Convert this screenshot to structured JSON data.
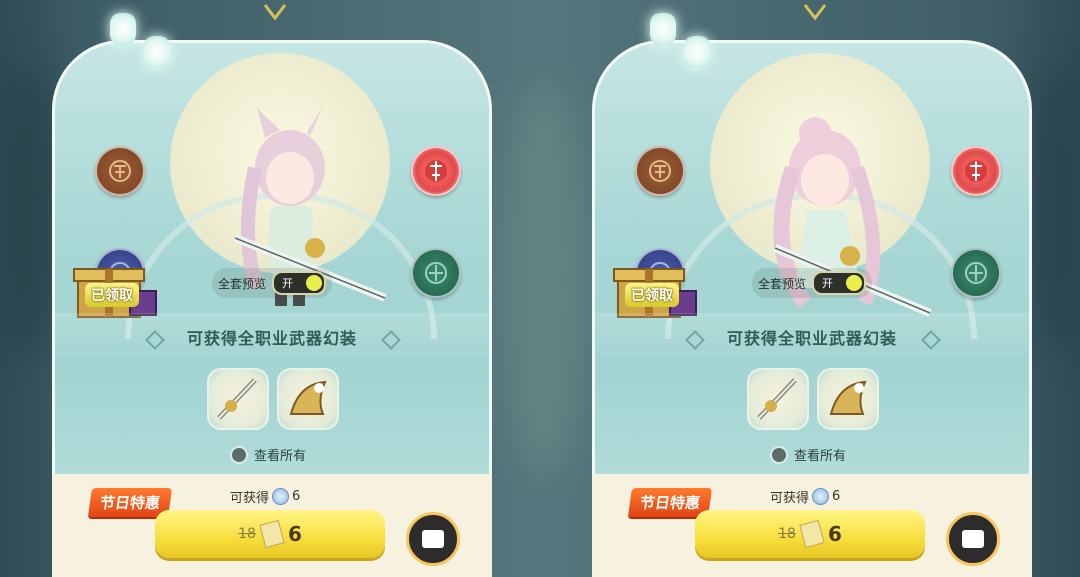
{
  "panels": [
    {
      "received_label": "已领取",
      "preview_label": "全套预览",
      "toggle_text": "开",
      "section_title": "可获得全职业武器幻装",
      "view_all": "查看所有",
      "promo_tag": "节日特惠",
      "obtain_label": "可获得",
      "obtain_count": "6",
      "old_price": "18",
      "new_price": "6"
    },
    {
      "received_label": "已领取",
      "preview_label": "全套预览",
      "toggle_text": "开",
      "section_title": "可获得全职业武器幻装",
      "view_all": "查看所有",
      "promo_tag": "节日特惠",
      "obtain_label": "可获得",
      "obtain_count": "6",
      "old_price": "18",
      "new_price": "6"
    }
  ],
  "colors": {
    "accent": "#f6df3c",
    "tag": "#e04416",
    "panel": "#a9d8d6"
  },
  "icons": [
    "lantern-icon",
    "emblem-brown-icon",
    "emblem-red-icon",
    "emblem-blue-icon",
    "emblem-green-icon",
    "gift-box-icon",
    "sword-icon",
    "claw-weapon-icon",
    "gem-icon",
    "ticket-icon",
    "gift-button-icon"
  ]
}
